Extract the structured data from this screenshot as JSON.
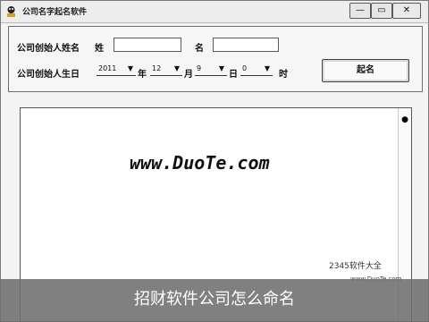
{
  "window": {
    "title": "公司名字起名软件",
    "buttons": {
      "minimize": "—",
      "maximize": "▭",
      "close": "✕"
    }
  },
  "form": {
    "name_label": "公司创始人姓名",
    "surname_label": "姓",
    "given_label": "名",
    "surname_value": "",
    "given_value": "",
    "birth_label": "公司创始人生日",
    "year_value": "2011",
    "year_suffix": "年",
    "month_value": "12",
    "month_suffix": "月",
    "day_value": "9",
    "day_suffix": "日",
    "hour_value": "0",
    "hour_suffix": "时",
    "submit_label": "起名"
  },
  "output": {
    "watermark": "www.DuoTe.com",
    "logo": "2345软件大全",
    "logo_sub": "www.DuoTe.com"
  },
  "caption": "招财软件公司怎么命名"
}
